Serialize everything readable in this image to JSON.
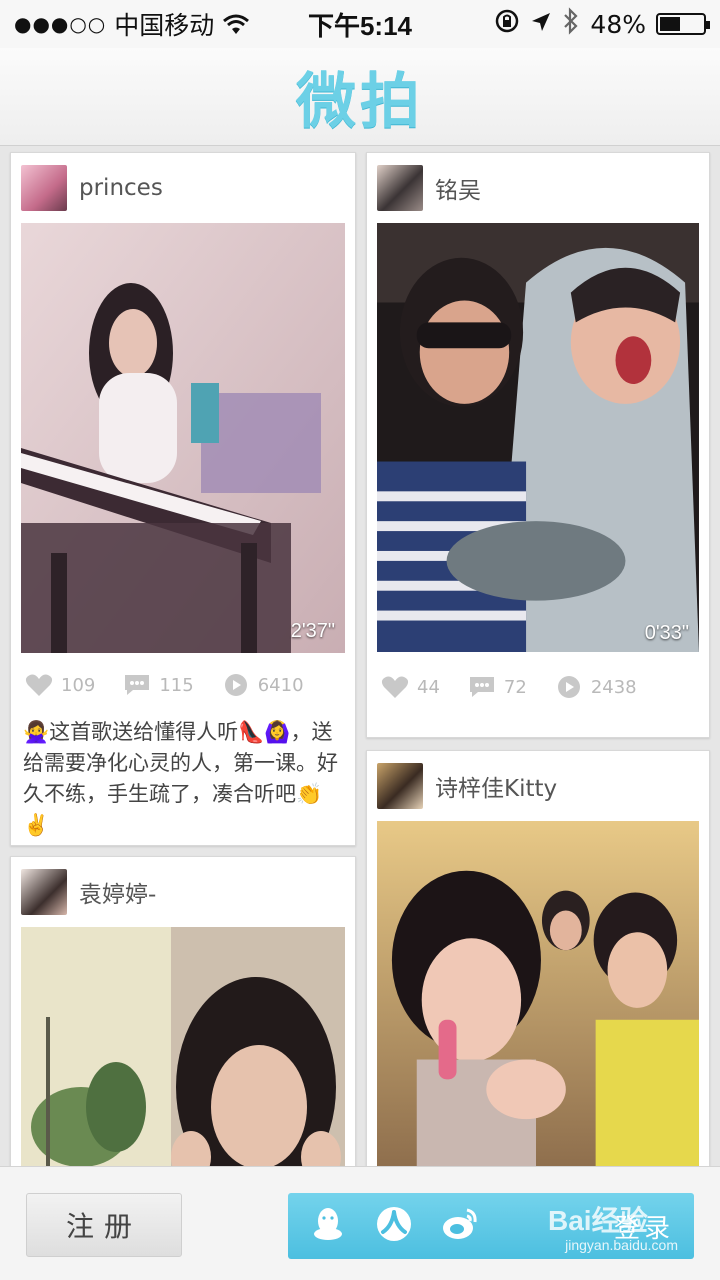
{
  "status_bar": {
    "signal": "●●●○○",
    "carrier": "中国移动",
    "time": "下午5:14",
    "battery_percent": "48%",
    "battery_level": 0.48
  },
  "header": {
    "title": "微拍"
  },
  "posts": [
    {
      "username": "princes",
      "duration": "2'37\"",
      "likes": "109",
      "comments": "115",
      "plays": "6410",
      "caption": "🙅‍♀️这首歌送给懂得人听👠🙆‍♀️，送给需要净化心灵的人，第一课。好久不练，手生疏了，凑合听吧👏✌️"
    },
    {
      "username": "铭吴",
      "duration": "0'33\"",
      "likes": "44",
      "comments": "72",
      "plays": "2438"
    },
    {
      "username": "袁婷婷-"
    },
    {
      "username": "诗梓佳Kitty"
    }
  ],
  "bottom_bar": {
    "register_label": "注册",
    "login_label": "登录",
    "watermark": "jingyan.baidu.com",
    "watermark_brand": "Bai经验"
  },
  "colors": {
    "accent": "#6cd0e6",
    "login_bar": "#4cbfe0"
  },
  "icons": [
    "wifi-icon",
    "location-icon",
    "bluetooth-icon",
    "battery-icon",
    "heart-icon",
    "comment-icon",
    "play-icon",
    "qq-icon",
    "renren-icon",
    "weibo-icon"
  ]
}
